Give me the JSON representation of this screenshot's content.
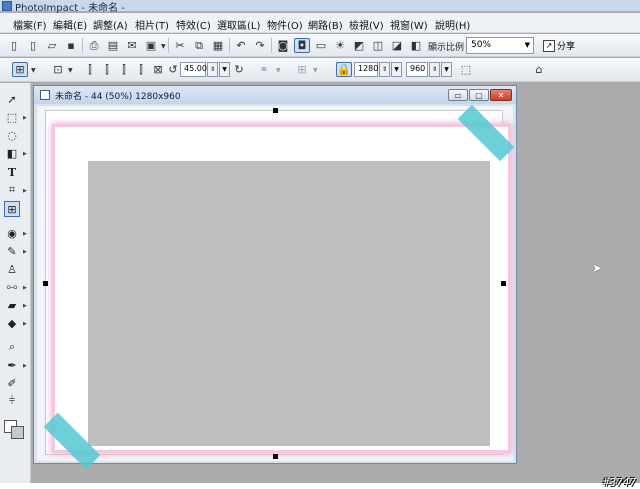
{
  "app": {
    "title": "PhotoImpact - 未命名 -"
  },
  "menubar": {
    "items": [
      {
        "label": "檔案(F)",
        "icon": "file"
      },
      {
        "label": "編輯(E)",
        "icon": "edit"
      },
      {
        "label": "調整(A)",
        "icon": "adjust"
      },
      {
        "label": "相片(T)",
        "icon": "photo"
      },
      {
        "label": "特效(C)",
        "icon": "effects"
      },
      {
        "label": "選取區(L)",
        "icon": "selection"
      },
      {
        "label": "物件(O)",
        "icon": "object"
      },
      {
        "label": "網路(B)",
        "icon": "web"
      },
      {
        "label": "檢視(V)",
        "icon": "view"
      },
      {
        "label": "視窗(W)",
        "icon": "window"
      },
      {
        "label": "說明(H)",
        "icon": "help"
      }
    ]
  },
  "toolbar1": {
    "zoom_label": "顯示比例",
    "zoom_value": "50%",
    "share_label": "分享"
  },
  "toolbar2": {
    "rotate_angle": "45.00",
    "width_value": "1280",
    "height_value": "960"
  },
  "document": {
    "caption": "未命名 - 44 (50%) 1280x960",
    "minimize_glyph": "▭",
    "restore_glyph": "▢",
    "close_glyph": "✕"
  },
  "colors": {
    "photo_fill": "#bebebe",
    "tape": "#52c8d4",
    "frame_glow": "#f1b0d2"
  },
  "watermark": "#3747"
}
